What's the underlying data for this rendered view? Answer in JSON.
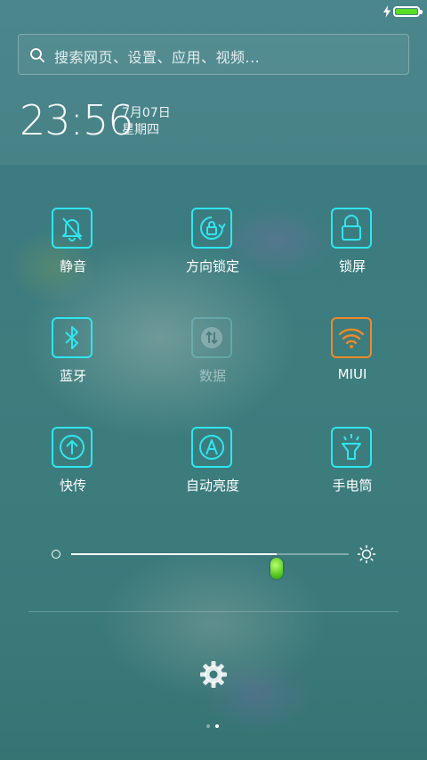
{
  "status_bar": {
    "battery_level": 1.0,
    "charging": true,
    "battery_color": "#4fdb18"
  },
  "search": {
    "placeholder": "搜索网页、设置、应用、视频..."
  },
  "clock": {
    "time": "23:56",
    "date": "7月07日",
    "weekday": "星期四"
  },
  "toggles": [
    {
      "label": "静音",
      "icon": "mute-bell-icon",
      "enabled": true
    },
    {
      "label": "方向锁定",
      "icon": "rotation-lock-icon",
      "enabled": true
    },
    {
      "label": "锁屏",
      "icon": "padlock-icon",
      "enabled": true
    },
    {
      "label": "蓝牙",
      "icon": "bluetooth-icon",
      "enabled": true
    },
    {
      "label": "数据",
      "icon": "mobile-data-icon",
      "enabled": false
    },
    {
      "label": "MIUI",
      "icon": "wifi-icon",
      "enabled": true,
      "active": true
    },
    {
      "label": "快传",
      "icon": "quick-transfer-icon",
      "enabled": true
    },
    {
      "label": "自动亮度",
      "icon": "auto-brightness-icon",
      "enabled": true
    },
    {
      "label": "手电筒",
      "icon": "flashlight-icon",
      "enabled": true
    }
  ],
  "brightness": {
    "level": 0.74
  },
  "pager": {
    "page_count": 2,
    "current_page": 2
  },
  "colors": {
    "accent": "#2fe6f0",
    "wifi_active": "#f08a24",
    "slider_thumb": "#4cc21a"
  }
}
